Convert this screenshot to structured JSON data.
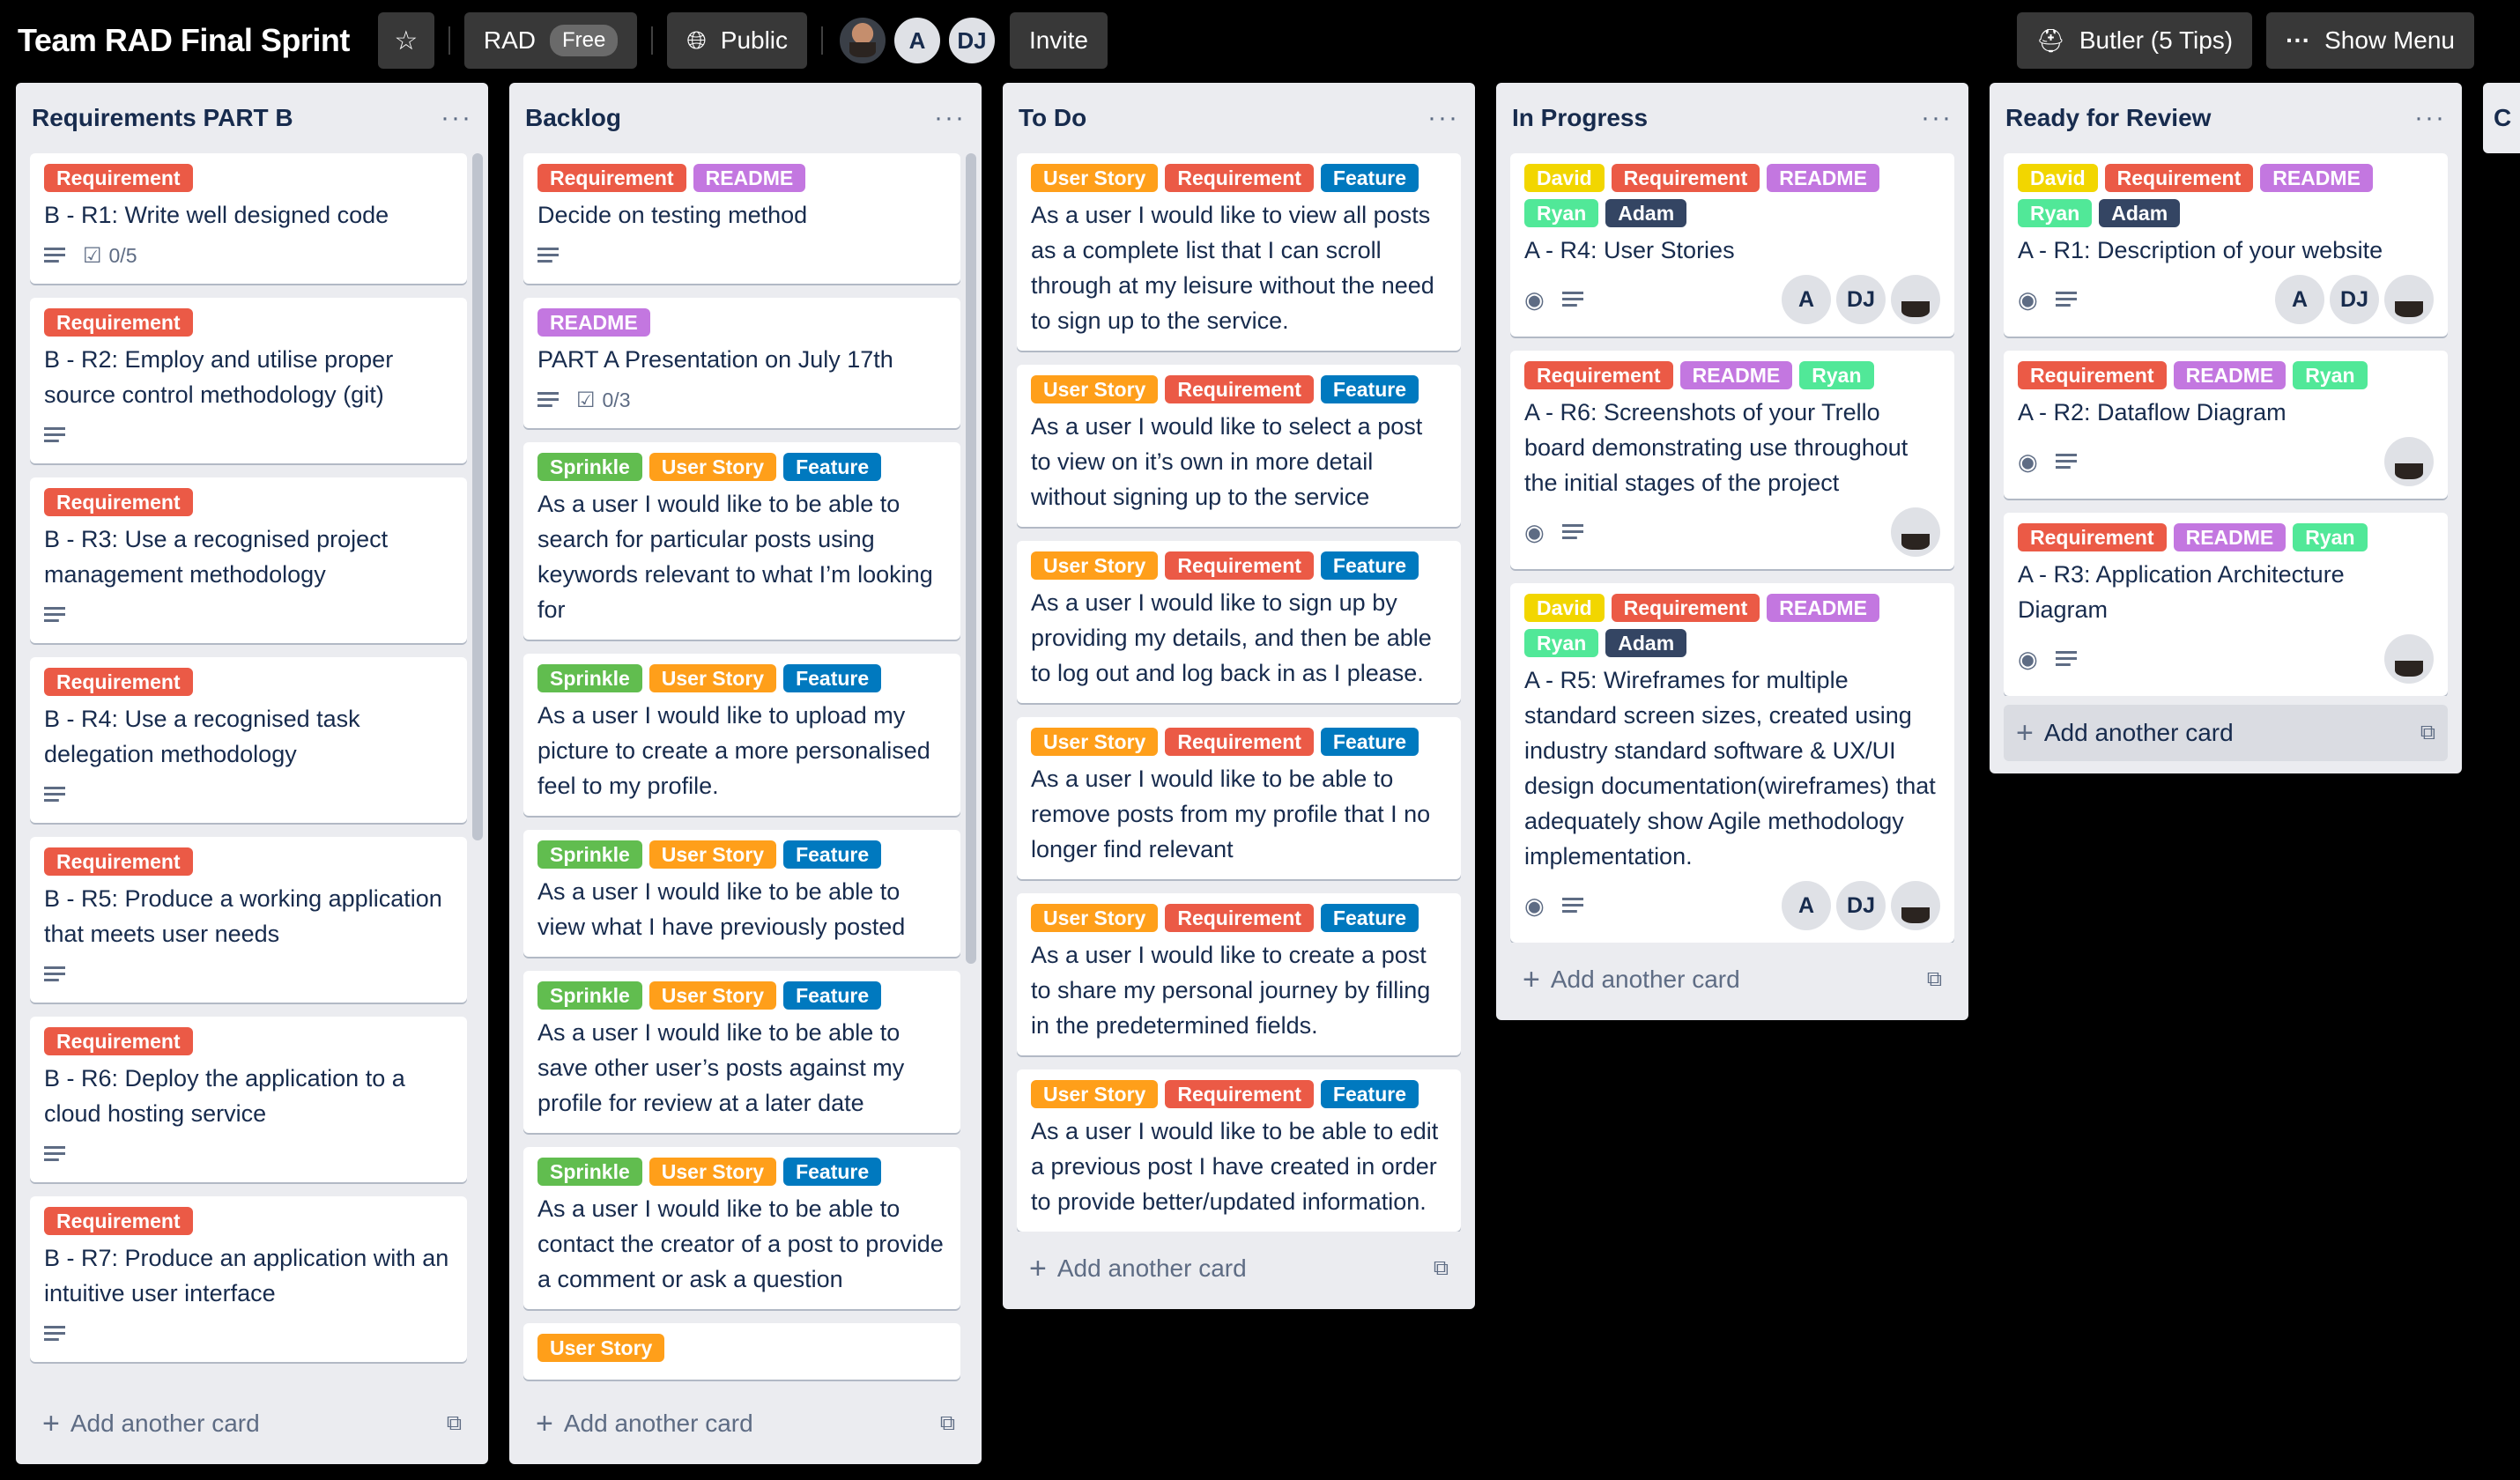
{
  "header": {
    "board_title": "Team RAD Final Sprint",
    "workspace": "RAD",
    "workspace_plan": "Free",
    "visibility": "Public",
    "members": [
      "A",
      "DJ"
    ],
    "invite": "Invite",
    "butler": "Butler (5 Tips)",
    "show_menu": "Show Menu"
  },
  "lists": [
    {
      "title": "Requirements PART B",
      "add_card": "Add another card",
      "cards": [
        {
          "title": "B - R1: Write well designed code",
          "checklist": "0/5"
        },
        {
          "title": "B - R2: Employ and utilise proper source control methodology (git)"
        },
        {
          "title": "B - R3: Use a recognised project management methodology"
        },
        {
          "title": "B - R4: Use a recognised task delegation methodology"
        },
        {
          "title": "B - R5: Produce a working application that meets user needs"
        },
        {
          "title": "B - R6: Deploy the application to a cloud hosting service"
        },
        {
          "title": "B - R7: Produce an application with an intuitive user interface"
        }
      ]
    },
    {
      "title": "Backlog",
      "add_card": "Add another card",
      "cards": [
        {
          "title": "Decide on testing method"
        },
        {
          "title": "PART A Presentation on July 17th",
          "checklist": "0/3"
        },
        {
          "title": "As a user I would like to be able to search for particular posts using keywords relevant to what I’m looking for"
        },
        {
          "title": "As a user I would like to upload my picture to create a more personalised feel to my profile."
        },
        {
          "title": "As a user I would like to be able to view what I have previously posted"
        },
        {
          "title": "As a user I would like to be able to save other user’s posts against my profile for review at a later date"
        },
        {
          "title": "As a user I would like to be able to contact the creator of a post to provide a comment or ask a question"
        }
      ]
    },
    {
      "title": "To Do",
      "add_card": "Add another card",
      "cards": [
        {
          "title": "As a user I would like to view all posts as a complete list that I can scroll through at my leisure without the need to sign up to the service."
        },
        {
          "title": "As a user I would like to select a post to view on it’s own in more detail without signing up to the service"
        },
        {
          "title": "As a user I would like to sign up by providing my details, and then be able to log out and log back in as I please."
        },
        {
          "title": "As a user I would like to be able to remove posts from my profile that I no longer find relevant"
        },
        {
          "title": "As a user I would like to create a post to share my personal journey by filling in the predetermined fields."
        },
        {
          "title": "As a user I would like to be able to edit a previous post I have created in order to provide better/updated information."
        }
      ]
    },
    {
      "title": "In Progress",
      "add_card": "Add another card",
      "cards": [
        {
          "title": "A - R4: User Stories"
        },
        {
          "title": "A - R6: Screenshots of your Trello board demonstrating use throughout the initial stages of the project"
        },
        {
          "title": "A - R5: Wireframes for multiple standard screen sizes, created using industry standard software & UX/UI design documentation(wireframes) that adequately show Agile methodology implementation."
        }
      ]
    },
    {
      "title": "Ready for Review",
      "add_card": "Add another card",
      "cards": [
        {
          "title": "A - R1: Description of your website"
        },
        {
          "title": "A - R2: Dataflow Diagram"
        },
        {
          "title": "A - R3: Application Architecture Diagram"
        }
      ]
    }
  ],
  "labels": {
    "requirement": "Requirement",
    "readme": "README",
    "sprinkle": "Sprinkle",
    "user_story": "User Story",
    "feature": "Feature",
    "david": "David",
    "ryan": "Ryan",
    "adam": "Adam"
  },
  "avatars": {
    "a": "A",
    "dj": "DJ"
  },
  "next_list_initial": "C"
}
